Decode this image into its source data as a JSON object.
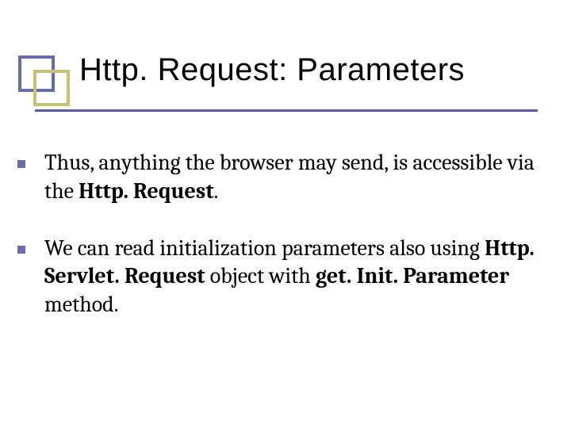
{
  "title": "Http. Request: Parameters",
  "bullets": [
    {
      "pre": "Thus, anything the browser may send, is  accessible via the ",
      "bold1": "Http. Request",
      "post": "."
    },
    {
      "pre": "We can read initialization parameters also using  ",
      "bold1": "Http. Servlet. Request",
      "mid": " object with ",
      "bold2": "get. Init. Parameter",
      "post": " method."
    }
  ]
}
